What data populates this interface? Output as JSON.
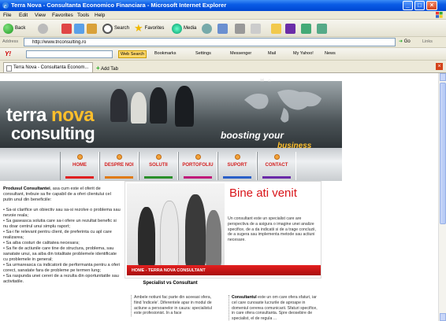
{
  "window": {
    "title": "Terra Nova - Consultanta Economico Financiara - Microsoft Internet Explorer"
  },
  "menu": [
    "File",
    "Edit",
    "View",
    "Favorites",
    "Tools",
    "Help"
  ],
  "toolbar": {
    "back": "Back",
    "search": "Search",
    "favorites": "Favorites",
    "media": "Media"
  },
  "address": {
    "label": "Address",
    "url": "http://www.tnconsulting.ro",
    "go": "Go",
    "links": "Links"
  },
  "yahoo": {
    "logo": "Y!",
    "search_button": "Web Search",
    "bookmarks": "Bookmarks",
    "settings": "Settings",
    "messenger": "Messenger",
    "mail": "Mail",
    "myyahoo": "My Yahoo!",
    "news": "News"
  },
  "tabs": {
    "active": "Terra Nova - Consultanta Econom...",
    "add": "Add Tab"
  },
  "banner": {
    "line1a": "terra",
    "line1b": "nova",
    "line2": "consulting",
    "tagline": "boosting your",
    "tagline2": "business"
  },
  "nav": [
    {
      "label": "HOME",
      "color": "#e02020"
    },
    {
      "label": "DESPRE NOI",
      "color": "#e07a10"
    },
    {
      "label": "SOLUTII",
      "color": "#2a8f2a"
    },
    {
      "label": "PORTOFOLIU",
      "color": "#c01a7a"
    },
    {
      "label": "SUPORT",
      "color": "#2a60c8"
    },
    {
      "label": "CONTACT",
      "color": "#6a2aa8"
    }
  ],
  "left": {
    "lead_bold": "Produsul Consultantei",
    "lead": ", asa cum este el oferit de consultant, trebuie sa fie capabil de a oferi clientului cel putin unul din beneficiile:",
    "bullets": [
      "• Sa-si clarifice un obiectiv sau sa-si rezolve o problema sau nevoie reala;",
      "• Sa gaseasca solutia care sa-i ofere un rezultat benefic si nu doar centrul unui simplu raport;",
      "• Sa-i fie relevant pentru client, de preferinta cu apl care realizarea;",
      "• Sa aiba costuri de calitatea necesara;",
      "• Sa fie de actiunile care tine de structura, problema, sau sanatate unui, sa aiba din totalitate problemele identificate cu problemele in general;",
      "• Sa urmareasca ca indicatorii de performanta pentru a oferi corect, sanatate fara de probleme pe termen lung;",
      "• Sa raspunda unei cereri de a rezulta din oportunitatile sau activitatile."
    ]
  },
  "welcome": {
    "title": "Bine ati venit",
    "text": "Un consultant este un specialist care are perspectiva de a asigura o imagine unei analize specifice, de a da indicatii si de a trage concluzii, de a sugera sau implementa metode sau actiuni necesare.",
    "bar": "HOME - TERRA NOVA CONSULTANT"
  },
  "specialist": {
    "heading": "Specialist vs Consultant",
    "text": "Ambele notiuni fac parte din aceeasi sfera, fiind 'indicele'. Diferentele apar in modul de actiune a persoanelor in cauza: specialistul este profesionist. In a face",
    "right_bold": "Consultantul",
    "right": "este un om care ofera sfaturi, iar cel care cunoaste lucrurile de aproape in domeniul cererea comunicarii. Sfaturi specifice, in care ofera consultanta. Spre deosebire de specialist, el de regula ..."
  }
}
